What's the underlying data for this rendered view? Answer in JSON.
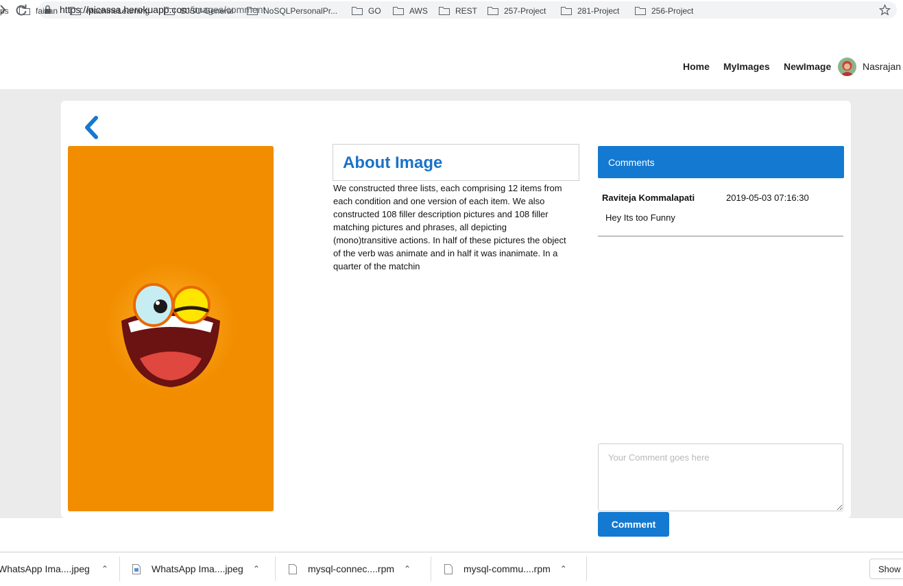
{
  "browser": {
    "url_host": "https://picassa.herokuapp.com",
    "url_path": "/images/comment",
    "bookmarks": [
      "ps",
      "faizan",
      "MachineLearning",
      "SJSU-General",
      "NoSQLPersonalPr...",
      "GO",
      "AWS",
      "REST",
      "257-Project",
      "281-Project",
      "256-Project"
    ]
  },
  "nav": {
    "links": [
      "Home",
      "MyImages",
      "NewImage"
    ],
    "user": "Nasrajan"
  },
  "about": {
    "title": "About Image",
    "description": "We constructed three lists, each comprising 12 items from each condition and one version of each item. We also constructed 108 filler description pictures and 108 filler matching pictures and phrases, all depicting (mono)transitive actions. In half of these pictures the object of the verb was animate and in half it was inanimate. In a quarter of the matchin"
  },
  "comments": {
    "title": "Comments",
    "items": [
      {
        "author": "Raviteja Kommalapati",
        "time": "2019-05-03 07:16:30",
        "text": "Hey Its too Funny"
      }
    ],
    "input_placeholder": "Your Comment goes here",
    "submit_label": "Comment"
  },
  "downloads": {
    "items": [
      "WhatsApp Ima....jpeg",
      "WhatsApp Ima....jpeg",
      "mysql-connec....rpm",
      "mysql-commu....rpm"
    ],
    "show_all": "Show"
  },
  "colors": {
    "accent": "#1479d1",
    "image_bg": "#f28d00"
  },
  "icons": [
    "reload-icon",
    "lock-icon",
    "star-icon",
    "folder-icon",
    "back-chevron-icon",
    "file-icon",
    "caret-up-icon"
  ]
}
